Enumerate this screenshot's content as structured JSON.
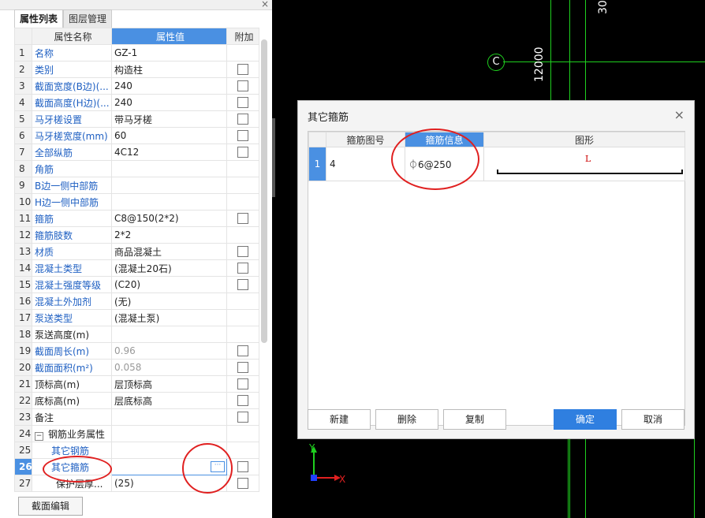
{
  "panel": {
    "tabs": [
      "属性列表",
      "图层管理"
    ],
    "headers": {
      "name": "属性名称",
      "value": "属性值",
      "extra": "附加"
    },
    "rows": [
      {
        "n": "1",
        "name": "名称",
        "value": "GZ-1",
        "chk": false,
        "style": "link"
      },
      {
        "n": "2",
        "name": "类别",
        "value": "构造柱",
        "chk": true,
        "style": "link"
      },
      {
        "n": "3",
        "name": "截面宽度(B边)(...",
        "value": "240",
        "chk": true,
        "style": "link"
      },
      {
        "n": "4",
        "name": "截面高度(H边)(...",
        "value": "240",
        "chk": true,
        "style": "link"
      },
      {
        "n": "5",
        "name": "马牙槎设置",
        "value": "带马牙槎",
        "chk": true,
        "style": "link"
      },
      {
        "n": "6",
        "name": "马牙槎宽度(mm)",
        "value": "60",
        "chk": true,
        "style": "link"
      },
      {
        "n": "7",
        "name": "全部纵筋",
        "value": "4C12",
        "chk": true,
        "style": "link"
      },
      {
        "n": "8",
        "name": "角筋",
        "value": "",
        "chk": false,
        "style": "link"
      },
      {
        "n": "9",
        "name": "B边一侧中部筋",
        "value": "",
        "chk": false,
        "style": "link"
      },
      {
        "n": "10",
        "name": "H边一侧中部筋",
        "value": "",
        "chk": false,
        "style": "link"
      },
      {
        "n": "11",
        "name": "箍筋",
        "value": "C8@150(2*2)",
        "chk": true,
        "style": "link"
      },
      {
        "n": "12",
        "name": "箍筋肢数",
        "value": "2*2",
        "chk": false,
        "style": "link"
      },
      {
        "n": "13",
        "name": "材质",
        "value": "商品混凝土",
        "chk": true,
        "style": "link"
      },
      {
        "n": "14",
        "name": "混凝土类型",
        "value": "(混凝土20石)",
        "chk": true,
        "style": "link"
      },
      {
        "n": "15",
        "name": "混凝土强度等级",
        "value": "(C20)",
        "chk": true,
        "style": "link"
      },
      {
        "n": "16",
        "name": "混凝土外加剂",
        "value": "(无)",
        "chk": false,
        "style": "link"
      },
      {
        "n": "17",
        "name": "泵送类型",
        "value": "(混凝土泵)",
        "chk": false,
        "style": "link"
      },
      {
        "n": "18",
        "name": "泵送高度(m)",
        "value": "",
        "chk": false,
        "style": "plain"
      },
      {
        "n": "19",
        "name": "截面周长(m)",
        "value": "0.96",
        "chk": true,
        "style": "link",
        "gray": true
      },
      {
        "n": "20",
        "name": "截面面积(m²)",
        "value": "0.058",
        "chk": true,
        "style": "link",
        "gray": true
      },
      {
        "n": "21",
        "name": "顶标高(m)",
        "value": "层顶标高",
        "chk": true,
        "style": "plain"
      },
      {
        "n": "22",
        "name": "底标高(m)",
        "value": "层底标高",
        "chk": true,
        "style": "plain"
      },
      {
        "n": "23",
        "name": "备注",
        "value": "",
        "chk": true,
        "style": "plain"
      },
      {
        "n": "24",
        "name": "钢筋业务属性",
        "value": "",
        "chk": false,
        "style": "group"
      },
      {
        "n": "25",
        "name": "其它钢筋",
        "value": "",
        "chk": false,
        "style": "child"
      },
      {
        "n": "26",
        "name": "其它箍筋",
        "value": "",
        "chk": true,
        "style": "child",
        "selected": true
      },
      {
        "n": "27",
        "name": "保护层厚...",
        "value": "(25)",
        "chk": true,
        "style": "child2"
      }
    ],
    "edit_button": "截面编辑",
    "close_glyph": "×"
  },
  "cad": {
    "axis_label": "C",
    "dim_text": "12000",
    "dim_text_top": "30"
  },
  "dialog": {
    "title": "其它箍筋",
    "close_glyph": "×",
    "headers": {
      "shape_no": "箍筋图号",
      "info": "箍筋信息",
      "shape": "图形"
    },
    "row": {
      "n": "1",
      "shape_no": "4",
      "info": "⏀6@250",
      "shape_letter": "L"
    },
    "buttons": {
      "new": "新建",
      "delete": "删除",
      "copy": "复制",
      "ok": "确定",
      "cancel": "取消"
    }
  },
  "axes": {
    "y": "Y",
    "x": "X"
  },
  "colors": {
    "accent": "#4a90e2",
    "cad_line": "#1fcf1f",
    "annotation": "#e02020"
  }
}
